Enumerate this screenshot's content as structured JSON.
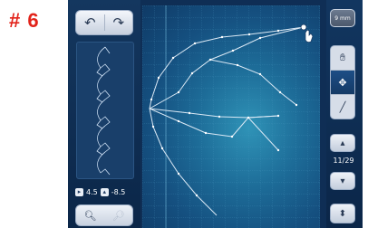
{
  "step_label": "# 6",
  "toolbar": {
    "undo_icon": "undo-icon",
    "redo_icon": "redo-icon"
  },
  "status": {
    "x_value": "4.5",
    "y_value": "-8.5"
  },
  "right_panel": {
    "size_label": "9 mm",
    "page": "11/29",
    "tools": [
      "hand-icon",
      "move-icon",
      "draw-icon"
    ]
  },
  "colors": {
    "background": "#0f2e55",
    "canvas": "#1d6c98",
    "accent": "#e2231a"
  }
}
